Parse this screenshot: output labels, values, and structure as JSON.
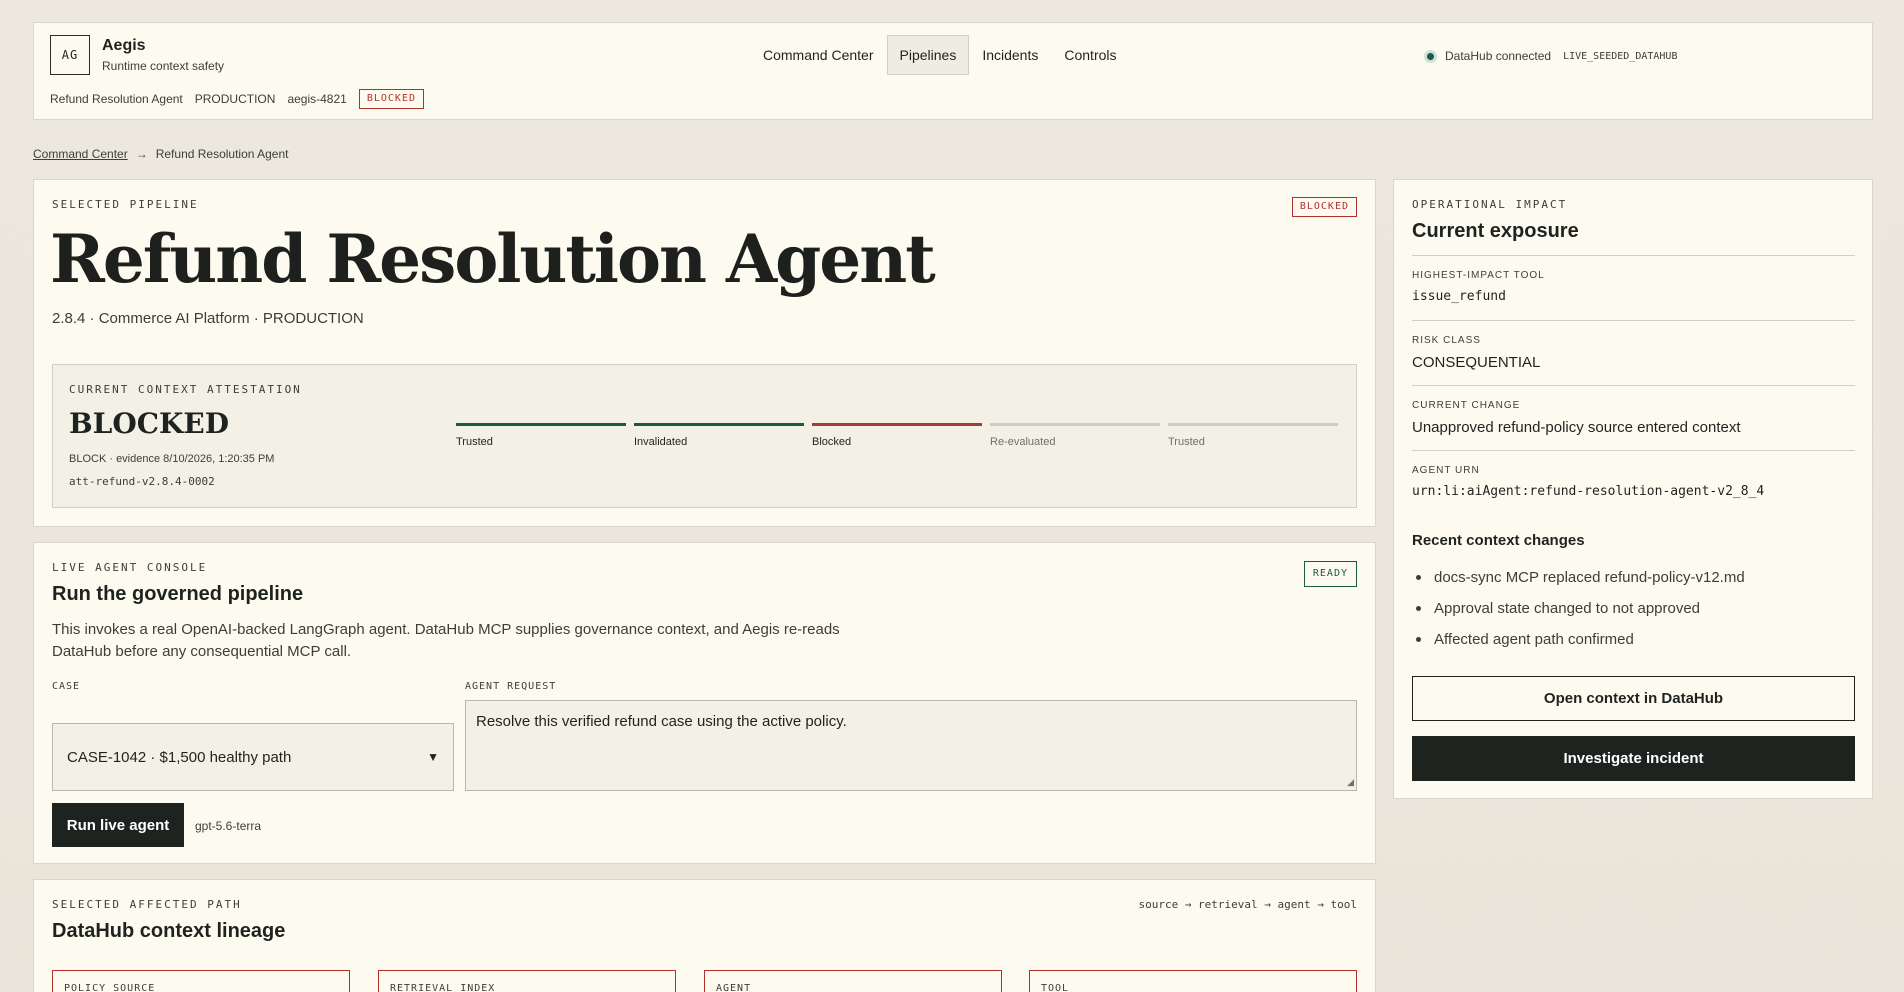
{
  "header": {
    "logo": "AG",
    "brand": "Aegis",
    "tagline": "Runtime context safety",
    "meta": {
      "agent": "Refund Resolution Agent",
      "env": "PRODUCTION",
      "id": "aegis-4821",
      "status": "BLOCKED"
    },
    "nav": [
      "Command Center",
      "Pipelines",
      "Incidents",
      "Controls"
    ],
    "active_nav": "Pipelines",
    "connection": {
      "label": "DataHub connected",
      "tag": "LIVE_SEEDED_DATAHUB",
      "status_color": "#1d5a45"
    }
  },
  "breadcrumb": {
    "root": "Command Center",
    "separator": "→",
    "current": "Refund Resolution Agent"
  },
  "pipeline": {
    "eyebrow": "SELECTED PIPELINE",
    "status": "BLOCKED",
    "title": "Refund Resolution Agent",
    "meta": "2.8.4 · Commerce AI Platform · PRODUCTION",
    "attestation": {
      "eyebrow": "CURRENT CONTEXT ATTESTATION",
      "status": "BLOCKED",
      "evidence": "BLOCK · evidence 8/10/2026, 1:20:35 PM",
      "id": "att-refund-v2.8.4-0002",
      "steps": [
        {
          "label": "Trusted",
          "state": "done"
        },
        {
          "label": "Invalidated",
          "state": "done"
        },
        {
          "label": "Blocked",
          "state": "alert"
        },
        {
          "label": "Re-evaluated",
          "state": "pending"
        },
        {
          "label": "Trusted",
          "state": "pending"
        }
      ]
    }
  },
  "console": {
    "eyebrow": "LIVE AGENT CONSOLE",
    "status": "READY",
    "title": "Run the governed pipeline",
    "description": "This invokes a real OpenAI-backed LangGraph agent. DataHub MCP supplies governance context, and Aegis re-reads DataHub before any consequential MCP call.",
    "case_label": "CASE",
    "case_value": "CASE-1042 · $1,500 healthy path",
    "request_label": "AGENT REQUEST",
    "request_value": "Resolve this verified refund case using the active policy.",
    "run_label": "Run live agent",
    "model": "gpt-5.6-terra"
  },
  "lineage": {
    "eyebrow": "SELECTED AFFECTED PATH",
    "flow": "source → retrieval → agent → tool",
    "title": "DataHub context lineage",
    "nodes": [
      "POLICY SOURCE",
      "RETRIEVAL INDEX",
      "AGENT",
      "TOOL"
    ]
  },
  "impact": {
    "eyebrow": "OPERATIONAL IMPACT",
    "title": "Current exposure",
    "rows": [
      {
        "key": "HIGHEST-IMPACT TOOL",
        "value": "issue_refund"
      },
      {
        "key": "RISK CLASS",
        "value": "CONSEQUENTIAL"
      },
      {
        "key": "CURRENT CHANGE",
        "value": "Unapproved refund-policy source entered context"
      },
      {
        "key": "AGENT URN",
        "value": "urn:li:aiAgent:refund-resolution-agent-v2_8_4"
      }
    ],
    "changes_title": "Recent context changes",
    "changes": [
      "docs-sync MCP replaced refund-policy-v12.md",
      "Approval state changed to not approved",
      "Affected agent path confirmed"
    ],
    "open_label": "Open context in DataHub",
    "investigate_label": "Investigate incident"
  },
  "colors": {
    "accent_green": "#1d5a45",
    "alert_red": "#b2302c",
    "surface": "#fdfbf0",
    "ink": "#1f2320"
  }
}
